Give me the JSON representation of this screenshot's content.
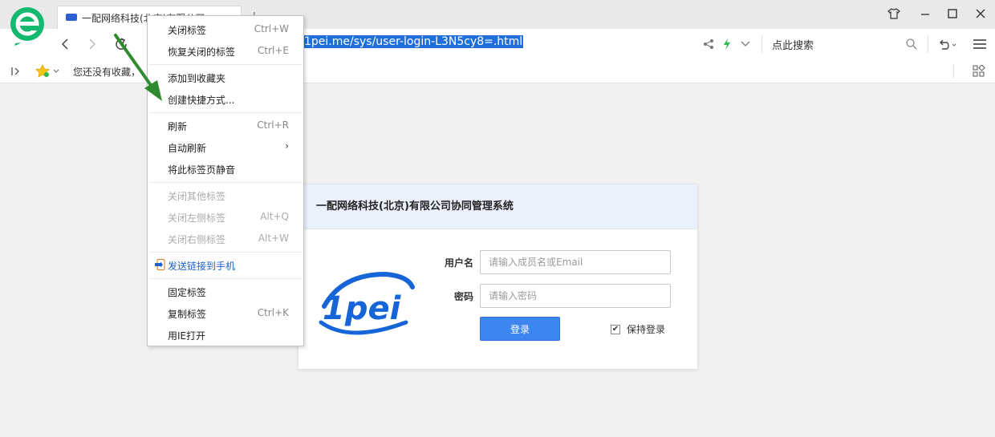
{
  "tab": {
    "title": "一配网络科技(北京)有限公司"
  },
  "address": {
    "url": "1pei.me/sys/user-login-L3N5cy8=.html",
    "search_placeholder": "点此搜索"
  },
  "bookmarks": {
    "empty_text": "您还没有收藏，"
  },
  "context_menu": {
    "close_tab": "关闭标签",
    "close_tab_key": "Ctrl+W",
    "restore_tab": "恢复关闭的标签",
    "restore_tab_key": "Ctrl+E",
    "add_favorite": "添加到收藏夹",
    "create_shortcut": "创建快捷方式...",
    "refresh": "刷新",
    "refresh_key": "Ctrl+R",
    "auto_refresh": "自动刷新",
    "mute_tab": "将此标签页静音",
    "close_others": "关闭其他标签",
    "close_left": "关闭左侧标签",
    "close_left_key": "Alt+Q",
    "close_right": "关闭右侧标签",
    "close_right_key": "Alt+W",
    "send_to_phone": "发送链接到手机",
    "pin_tab": "固定标签",
    "duplicate_tab": "复制标签",
    "duplicate_tab_key": "Ctrl+K",
    "open_ie": "用IE打开"
  },
  "login": {
    "header": "一配网络科技(北京)有限公司协同管理系统",
    "brand": "1pei",
    "username_label": "用户名",
    "username_placeholder": "请输入成员名或Email",
    "password_label": "密码",
    "password_placeholder": "请输入密码",
    "submit_label": "登录",
    "remember_label": "保持登录",
    "remember_checked": true
  },
  "colors": {
    "accent": "#3d86f2",
    "brand_blue": "#1565d8",
    "browser_green": "#14b86f"
  }
}
